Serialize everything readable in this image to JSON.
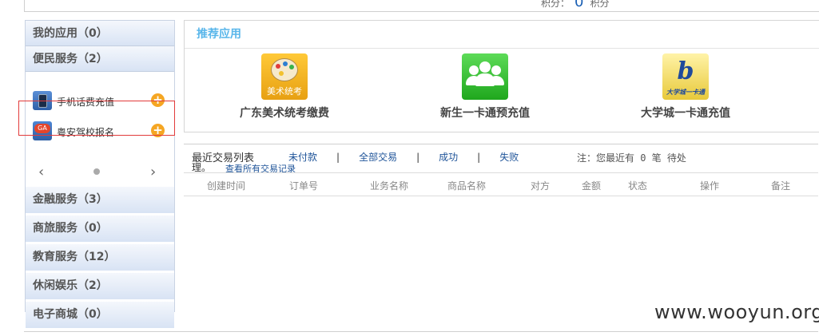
{
  "header": {
    "points_label": "积分：",
    "points_value": "0",
    "points_unit": "积分"
  },
  "sidebar": {
    "categories": [
      {
        "label": "我的应用（0）"
      },
      {
        "label": "便民服务（2）"
      },
      {
        "label": "金融服务（3）"
      },
      {
        "label": "商旅服务（0）"
      },
      {
        "label": "教育服务（12）"
      },
      {
        "label": "休闲娱乐（2）"
      },
      {
        "label": "电子商城（0）"
      }
    ],
    "services": [
      {
        "label": "手机话费充值",
        "add": "+"
      },
      {
        "label": "粤安驾校报名",
        "add": "+"
      }
    ],
    "carousel": {
      "prev": "‹",
      "next": "›"
    }
  },
  "recommended": {
    "title": "推荐应用",
    "apps": [
      {
        "name": "广东美术统考缴费",
        "icon_caption": "美术统考"
      },
      {
        "name": "新生一卡通预充值"
      },
      {
        "name": "大学城一卡通充值",
        "icon_caption": "大学城一卡通",
        "icon_logo": "b"
      }
    ]
  },
  "transactions": {
    "title": "最近交易列表",
    "title_wrap": "理。",
    "filters": [
      "未付款",
      "全部交易",
      "成功",
      "失败"
    ],
    "separator": "|",
    "note": "注：您最近有 0 笔 待处",
    "view_all": "查看所有交易记录",
    "columns": [
      "创建时间",
      "订单号",
      "业务名称",
      "商品名称",
      "对方",
      "金额",
      "状态",
      "操作",
      "备注"
    ]
  },
  "watermark": "www.wooyun.org",
  "colors": {
    "accent": "#59b6ea",
    "link": "#1f5499",
    "highlight": "#e23b3b",
    "add_button": "#f5a623"
  }
}
